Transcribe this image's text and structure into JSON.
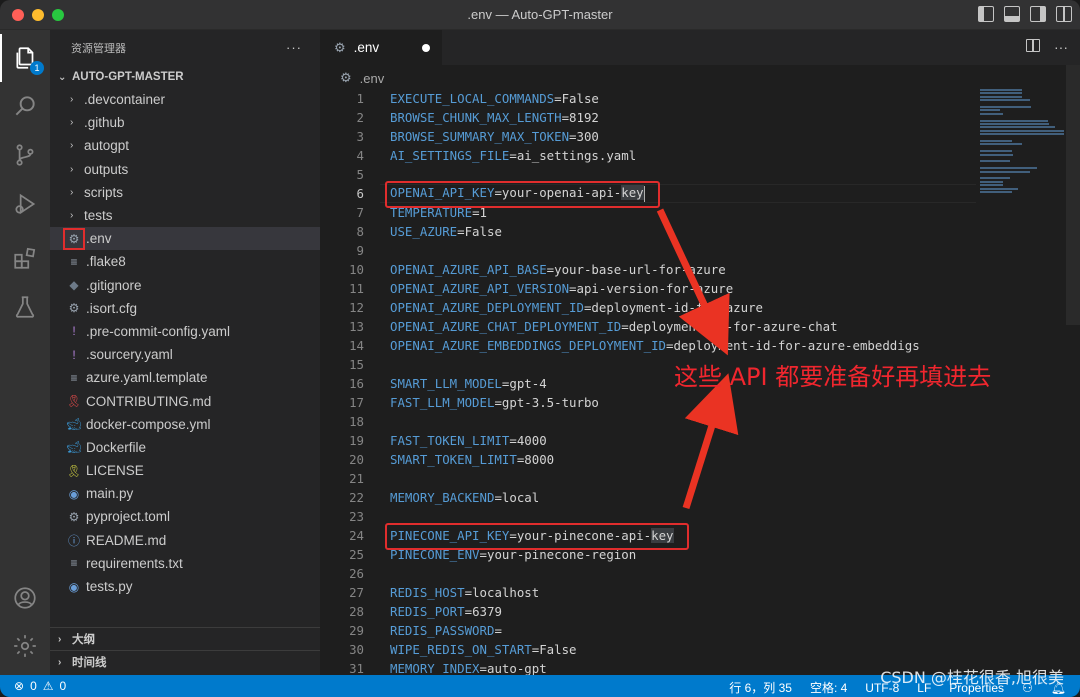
{
  "window": {
    "title": ".env — Auto-GPT-master"
  },
  "activity": {
    "explorer_badge": "1"
  },
  "sidebar": {
    "header": "资源管理器",
    "more": "···",
    "root": "AUTO-GPT-MASTER",
    "folders": [
      ".devcontainer",
      ".github",
      "autogpt",
      "outputs",
      "scripts",
      "tests"
    ],
    "files": [
      {
        "name": ".env",
        "icon": "gear",
        "selected": true
      },
      {
        "name": ".flake8",
        "icon": "lines"
      },
      {
        "name": ".gitignore",
        "icon": "diamond"
      },
      {
        "name": ".isort.cfg",
        "icon": "gear"
      },
      {
        "name": ".pre-commit-config.yaml",
        "icon": "exclaim"
      },
      {
        "name": ".sourcery.yaml",
        "icon": "exclaim"
      },
      {
        "name": "azure.yaml.template",
        "icon": "lines"
      },
      {
        "name": "CONTRIBUTING.md",
        "icon": "ribbon"
      },
      {
        "name": "docker-compose.yml",
        "icon": "whale"
      },
      {
        "name": "Dockerfile",
        "icon": "whale"
      },
      {
        "name": "LICENSE",
        "icon": "license"
      },
      {
        "name": "main.py",
        "icon": "python"
      },
      {
        "name": "pyproject.toml",
        "icon": "gear"
      },
      {
        "name": "README.md",
        "icon": "info"
      },
      {
        "name": "requirements.txt",
        "icon": "lines"
      },
      {
        "name": "tests.py",
        "icon": "python"
      }
    ],
    "outline": "大纲",
    "timeline": "时间线"
  },
  "editor": {
    "tab": ".env",
    "breadcrumb": ".env",
    "lines": [
      {
        "n": "1",
        "k": "EXECUTE_LOCAL_COMMANDS",
        "v": "=False"
      },
      {
        "n": "2",
        "k": "BROWSE_CHUNK_MAX_LENGTH",
        "v": "=8192"
      },
      {
        "n": "3",
        "k": "BROWSE_SUMMARY_MAX_TOKEN",
        "v": "=300"
      },
      {
        "n": "4",
        "k": "AI_SETTINGS_FILE",
        "v": "=ai_settings.yaml"
      },
      {
        "n": "5",
        "k": "",
        "v": ""
      },
      {
        "n": "6",
        "k": "OPENAI_API_KEY",
        "v": "=your-openai-api-",
        "sel": "key"
      },
      {
        "n": "7",
        "k": "TEMPERATURE",
        "v": "=1"
      },
      {
        "n": "8",
        "k": "USE_AZURE",
        "v": "=False"
      },
      {
        "n": "9",
        "k": "",
        "v": ""
      },
      {
        "n": "10",
        "k": "OPENAI_AZURE_API_BASE",
        "v": "=your-base-url-for-azure"
      },
      {
        "n": "11",
        "k": "OPENAI_AZURE_API_VERSION",
        "v": "=api-version-for-azure"
      },
      {
        "n": "12",
        "k": "OPENAI_AZURE_DEPLOYMENT_ID",
        "v": "=deployment-id-for-azure"
      },
      {
        "n": "13",
        "k": "OPENAI_AZURE_CHAT_DEPLOYMENT_ID",
        "v": "=deployment-id-for-azure-chat"
      },
      {
        "n": "14",
        "k": "OPENAI_AZURE_EMBEDDINGS_DEPLOYMENT_ID",
        "v": "=deployment-id-for-azure-embeddigs"
      },
      {
        "n": "15",
        "k": "",
        "v": ""
      },
      {
        "n": "16",
        "k": "SMART_LLM_MODEL",
        "v": "=gpt-4"
      },
      {
        "n": "17",
        "k": "FAST_LLM_MODEL",
        "v": "=gpt-3.5-turbo"
      },
      {
        "n": "18",
        "k": "",
        "v": ""
      },
      {
        "n": "19",
        "k": "FAST_TOKEN_LIMIT",
        "v": "=4000"
      },
      {
        "n": "20",
        "k": "SMART_TOKEN_LIMIT",
        "v": "=8000"
      },
      {
        "n": "21",
        "k": "",
        "v": ""
      },
      {
        "n": "22",
        "k": "MEMORY_BACKEND",
        "v": "=local"
      },
      {
        "n": "23",
        "k": "",
        "v": ""
      },
      {
        "n": "24",
        "k": "PINECONE_API_KEY",
        "v": "=your-pinecone-api-",
        "sel": "key"
      },
      {
        "n": "25",
        "k": "PINECONE_ENV",
        "v": "=your-pinecone-region"
      },
      {
        "n": "26",
        "k": "",
        "v": ""
      },
      {
        "n": "27",
        "k": "REDIS_HOST",
        "v": "=localhost"
      },
      {
        "n": "28",
        "k": "REDIS_PORT",
        "v": "=6379"
      },
      {
        "n": "29",
        "k": "REDIS_PASSWORD",
        "v": "="
      },
      {
        "n": "30",
        "k": "WIPE_REDIS_ON_START",
        "v": "=False"
      },
      {
        "n": "31",
        "k": "MEMORY_INDEX",
        "v": "=auto-gpt"
      }
    ],
    "annotation": "这些 API 都要准备好再填进去"
  },
  "status": {
    "errors": "0",
    "warnings": "0",
    "position": "行 6，列 35",
    "indent": "空格: 4",
    "encoding": "UTF-8",
    "eol": "LF",
    "language": "Properties"
  },
  "watermark": "CSDN @桂花很香,旭很美",
  "colors": {
    "accent": "#007acc",
    "annotation": "#e02d2d",
    "key": "#569cd6"
  }
}
